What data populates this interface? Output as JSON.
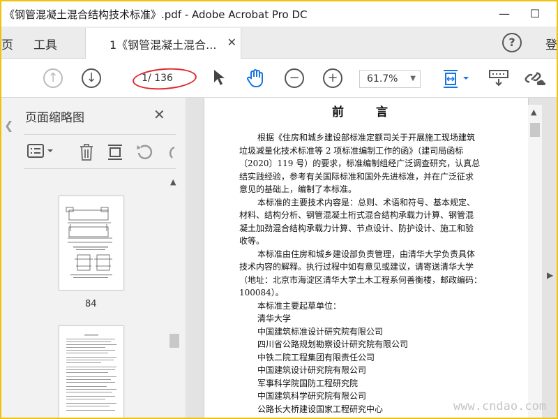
{
  "window": {
    "title": "《钢管混凝土混合结构技术标准》.pdf - Adobe Acrobat Pro DC",
    "minimize_label": "—",
    "maximize_label": "☐"
  },
  "tabs": {
    "prev_label": "页",
    "tools_label": "工具",
    "doc_label": "1《钢管混凝土混合...",
    "close_label": "✕",
    "help_label": "?",
    "login_label": "登"
  },
  "toolbar": {
    "page_current": "1",
    "page_total": "/ 136",
    "zoom_value": "61.7%"
  },
  "left_panel": {
    "title": "页面缩略图",
    "close_label": "✕",
    "thumbnail_page_label": "84"
  },
  "document": {
    "heading": "前 言",
    "lines": [
      {
        "indent": true,
        "text": "根据《住房和城乡建设部标准定额司关于开展施工现场建筑"
      },
      {
        "indent": false,
        "text": "垃圾减量化技术标准等 2 项标准编制工作的函》（建司局函标"
      },
      {
        "indent": false,
        "text": "〔2020〕119 号）的要求，标准编制组经广泛调查研究，认真总"
      },
      {
        "indent": false,
        "text": "结实践经验，参考有关国际标准和国外先进标准，并在广泛征求"
      },
      {
        "indent": false,
        "text": "意见的基础上，编制了本标准。"
      },
      {
        "indent": true,
        "text": "本标准的主要技术内容是：总则、术语和符号、基本规定、"
      },
      {
        "indent": false,
        "text": "材料、结构分析、钢管混凝土桁式混合结构承载力计算、钢管混"
      },
      {
        "indent": false,
        "text": "凝土加劲混合结构承载力计算、节点设计、防护设计、施工和验"
      },
      {
        "indent": false,
        "text": "收等。"
      },
      {
        "indent": true,
        "text": "本标准由住房和城乡建设部负责管理，由清华大学负责具体"
      },
      {
        "indent": false,
        "text": "技术内容的解释。执行过程中如有意见或建议，请寄送清华大学"
      },
      {
        "indent": false,
        "text": "（地址：北京市海淀区清华大学土木工程系何善衡楼，邮政编码："
      },
      {
        "indent": false,
        "text": "100084）。"
      },
      {
        "indent": true,
        "text": "本标准主要起草单位："
      },
      {
        "indent": true,
        "text": "清华大学"
      },
      {
        "indent": true,
        "text": "中国建筑标准设计研究院有限公司"
      },
      {
        "indent": true,
        "text": "四川省公路规划勘察设计研究院有限公司"
      },
      {
        "indent": true,
        "text": "中铁二院工程集团有限责任公司"
      },
      {
        "indent": true,
        "text": "中国建筑设计研究院有限公司"
      },
      {
        "indent": true,
        "text": "军事科学院国防工程研究院"
      },
      {
        "indent": true,
        "text": "中国建筑科学研究院有限公司"
      },
      {
        "indent": true,
        "text": "公路长大桥建设国家工程研究中心"
      }
    ]
  },
  "watermark": "www.cndao.com",
  "colors": {
    "frame_border": "#f0c20a",
    "annotation_ellipse": "#e0262b",
    "active_tool": "#1473e6"
  }
}
